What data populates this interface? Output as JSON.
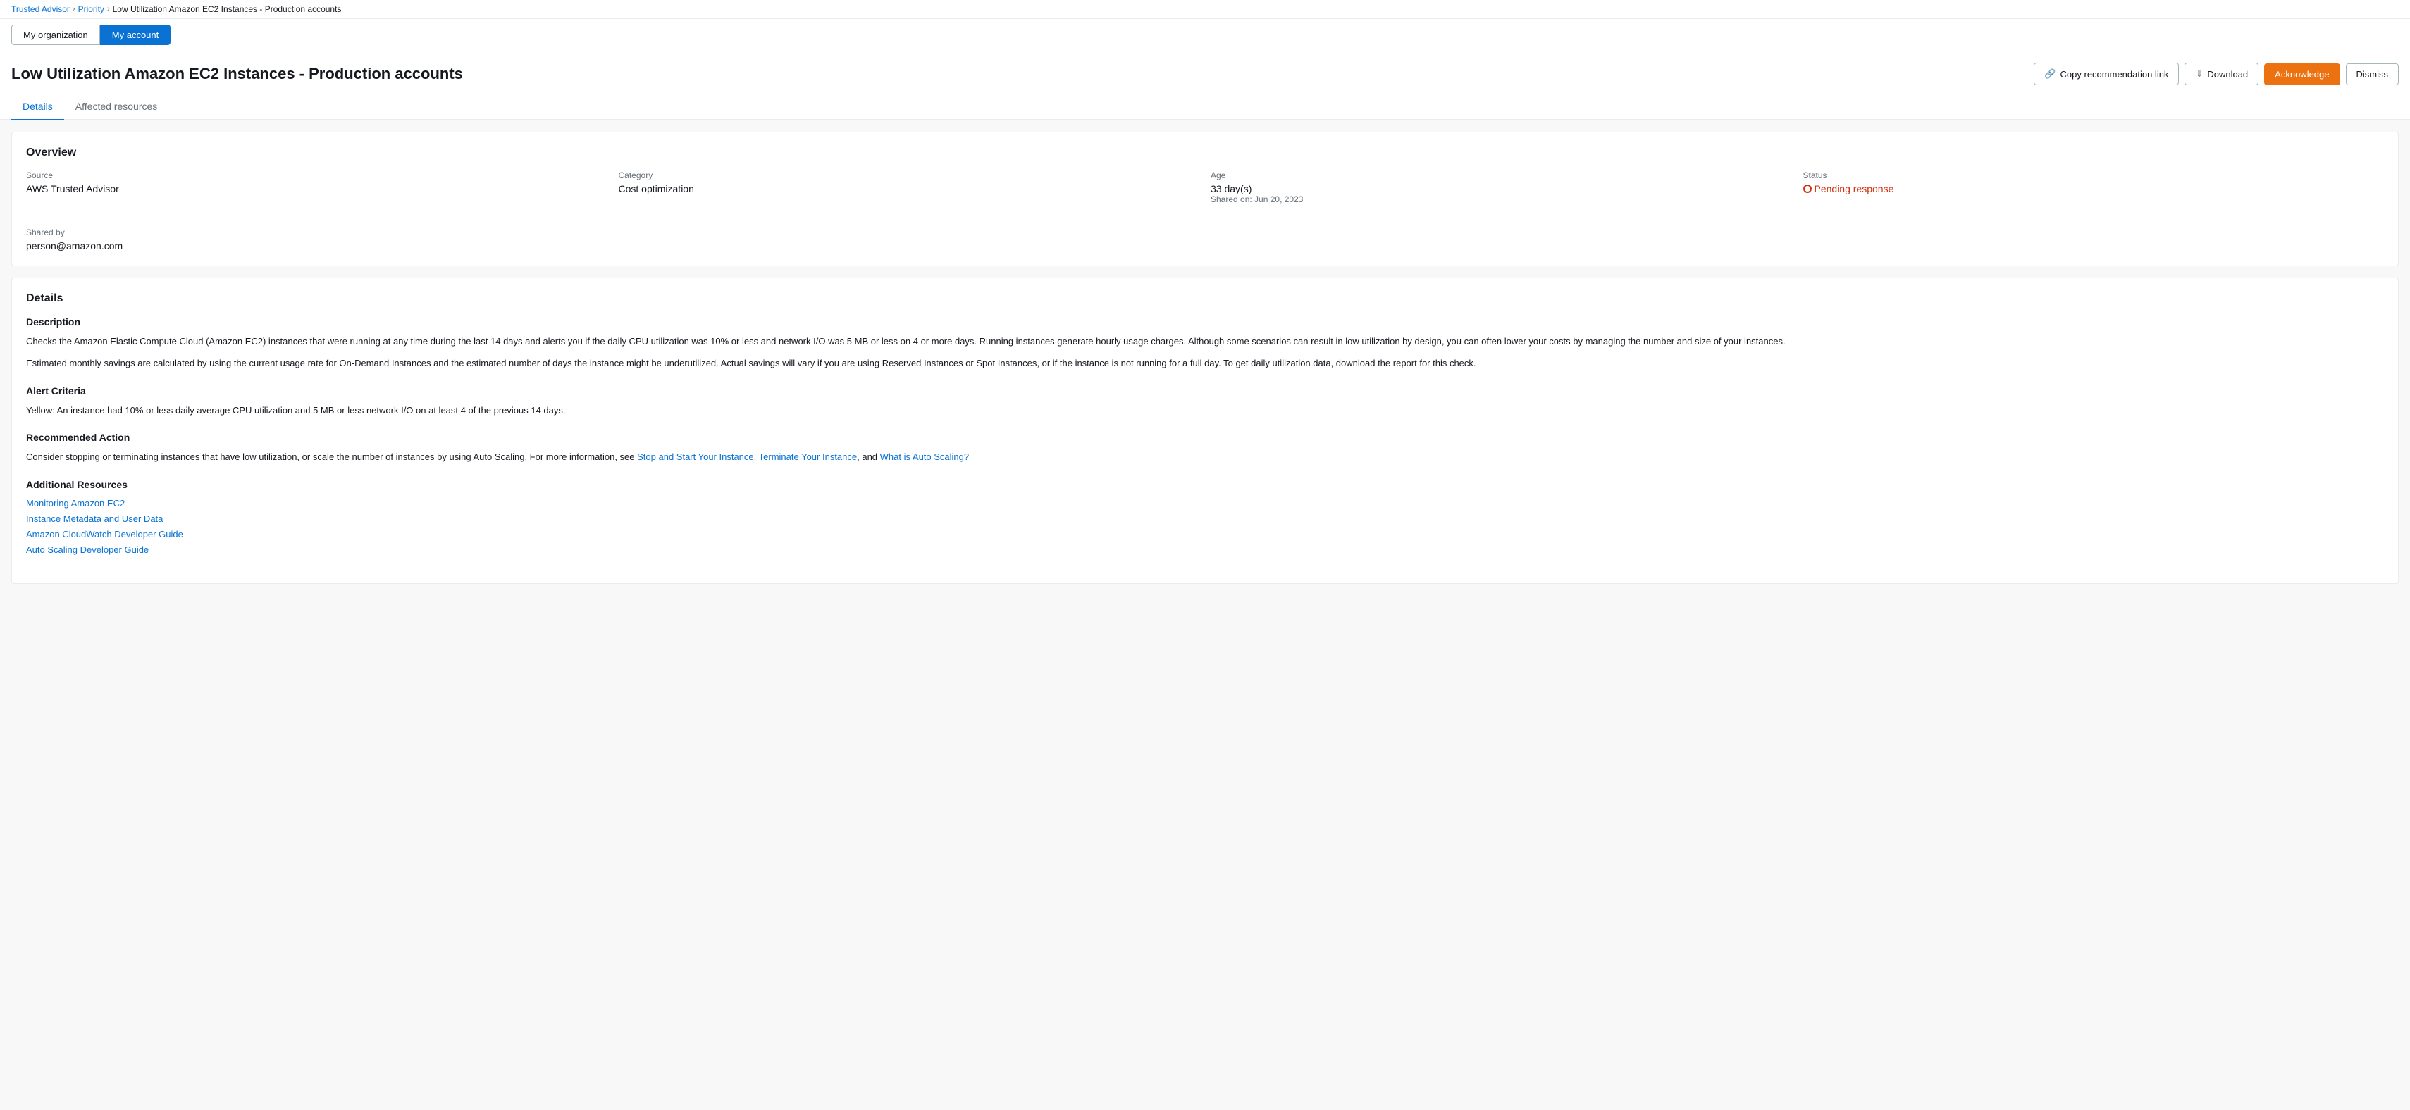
{
  "breadcrumb": {
    "items": [
      {
        "label": "Trusted Advisor",
        "href": "#"
      },
      {
        "label": "Priority",
        "href": "#"
      },
      {
        "label": "Low Utilization Amazon EC2 Instances - Production accounts"
      }
    ]
  },
  "account_switcher": {
    "my_organization": "My organization",
    "my_account": "My account"
  },
  "page": {
    "title": "Low Utilization Amazon EC2 Instances - Production accounts"
  },
  "header_actions": {
    "copy_link_label": "Copy recommendation link",
    "download_label": "Download",
    "acknowledge_label": "Acknowledge",
    "dismiss_label": "Dismiss"
  },
  "tabs": [
    {
      "label": "Details",
      "active": true
    },
    {
      "label": "Affected resources",
      "active": false
    }
  ],
  "overview": {
    "title": "Overview",
    "source_label": "Source",
    "source_value": "AWS Trusted Advisor",
    "category_label": "Category",
    "category_value": "Cost optimization",
    "age_label": "Age",
    "age_value": "33 day(s)",
    "age_shared": "Shared on: Jun 20, 2023",
    "status_label": "Status",
    "status_value": "Pending response",
    "shared_by_label": "Shared by",
    "shared_by_value": "person@amazon.com"
  },
  "details": {
    "title": "Details",
    "description_title": "Description",
    "description_p1": "Checks the Amazon Elastic Compute Cloud (Amazon EC2) instances that were running at any time during the last 14 days and alerts you if the daily CPU utilization was 10% or less and network I/O was 5 MB or less on 4 or more days. Running instances generate hourly usage charges. Although some scenarios can result in low utilization by design, you can often lower your costs by managing the number and size of your instances.",
    "description_p2": "Estimated monthly savings are calculated by using the current usage rate for On-Demand Instances and the estimated number of days the instance might be underutilized. Actual savings will vary if you are using Reserved Instances or Spot Instances, or if the instance is not running for a full day. To get daily utilization data, download the report for this check.",
    "alert_criteria_title": "Alert Criteria",
    "alert_criteria_text": "Yellow: An instance had 10% or less daily average CPU utilization and 5 MB or less network I/O on at least 4 of the previous 14 days.",
    "recommended_action_title": "Recommended Action",
    "recommended_action_text_before": "Consider stopping or terminating instances that have low utilization, or scale the number of instances by using Auto Scaling. For more information, see ",
    "recommended_action_link1_label": "Stop and Start Your Instance",
    "recommended_action_link1_href": "#",
    "recommended_action_text_between1": ", ",
    "recommended_action_link2_label": "Terminate Your Instance",
    "recommended_action_link2_href": "#",
    "recommended_action_text_between2": ", and ",
    "recommended_action_link3_label": "What is Auto Scaling?",
    "recommended_action_link3_href": "#",
    "additional_resources_title": "Additional Resources",
    "additional_resources": [
      {
        "label": "Monitoring Amazon EC2",
        "href": "#"
      },
      {
        "label": "Instance Metadata and User Data",
        "href": "#"
      },
      {
        "label": "Amazon CloudWatch Developer Guide",
        "href": "#"
      },
      {
        "label": "Auto Scaling Developer Guide",
        "href": "#"
      }
    ]
  }
}
